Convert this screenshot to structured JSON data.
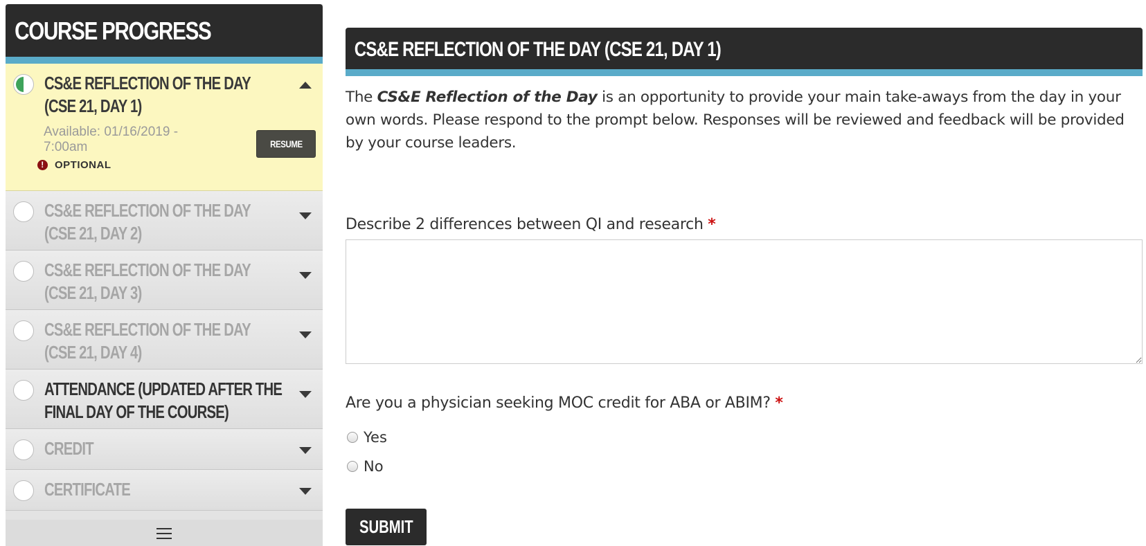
{
  "sidebar": {
    "title": "COURSE PROGRESS",
    "items": [
      {
        "label": "CS&E REFLECTION OF THE DAY (CSE 21, DAY 1)",
        "status": "in-progress",
        "available": "Available: 01/16/2019 - 7:00am",
        "badge": "OPTIONAL",
        "badge_icon": "!",
        "action_label": "RESUME",
        "expanded": true
      },
      {
        "label": "CS&E REFLECTION OF THE DAY (CSE 21, DAY 2)",
        "status": "locked"
      },
      {
        "label": "CS&E REFLECTION OF THE DAY (CSE 21, DAY 3)",
        "status": "locked"
      },
      {
        "label": "CS&E REFLECTION OF THE DAY (CSE 21, DAY 4)",
        "status": "locked"
      },
      {
        "label": "ATTENDANCE (UPDATED AFTER THE FINAL DAY OF THE COURSE)",
        "status": "not-started"
      },
      {
        "label": "CREDIT",
        "status": "locked"
      },
      {
        "label": "CERTIFICATE",
        "status": "locked"
      }
    ],
    "footer_icon": "hamburger-menu-icon"
  },
  "main": {
    "title": "CS&E REFLECTION OF THE DAY (CSE 21, DAY 1)",
    "intro_pre": "The ",
    "intro_em": "CS&E Reflection of the Day",
    "intro_post": " is an opportunity to provide your main take-aways from the day in your own words. Please respond to the prompt below. Responses will be reviewed and feedback will be provided by your course leaders.",
    "question1": "Describe 2 differences between QI and research",
    "question1_value": "",
    "question2": "Are you a physician seeking MOC credit for ABA or ABIM?",
    "required_mark": "*",
    "options": [
      "Yes",
      "No"
    ],
    "submit_label": "SUBMIT"
  },
  "colors": {
    "header_bg": "#2b2b2b",
    "accent_bar": "#5aabc9",
    "active_item_bg": "#fcf7c0",
    "required": "#cc1111",
    "progress_green": "#3ea35a",
    "optional_icon": "#8b1111"
  }
}
